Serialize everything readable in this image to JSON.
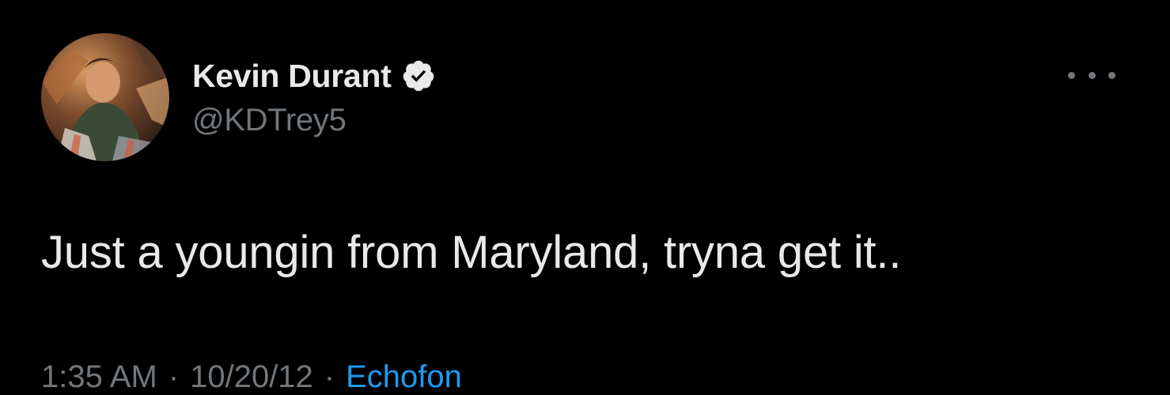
{
  "tweet": {
    "author": {
      "display_name": "Kevin Durant",
      "handle": "@KDTrey5",
      "verified": true
    },
    "text": "Just a youngin from Maryland, tryna get it..",
    "time": "1:35 AM",
    "date": "10/20/12",
    "separator": "·",
    "source": "Echofon"
  },
  "icons": {
    "verified": "verified-badge-icon",
    "more": "more-options-icon",
    "avatar": "profile-avatar"
  },
  "colors": {
    "background": "#000000",
    "primary_text": "#e7e9ea",
    "secondary_text": "#71767b",
    "link": "#1d9bf0"
  }
}
